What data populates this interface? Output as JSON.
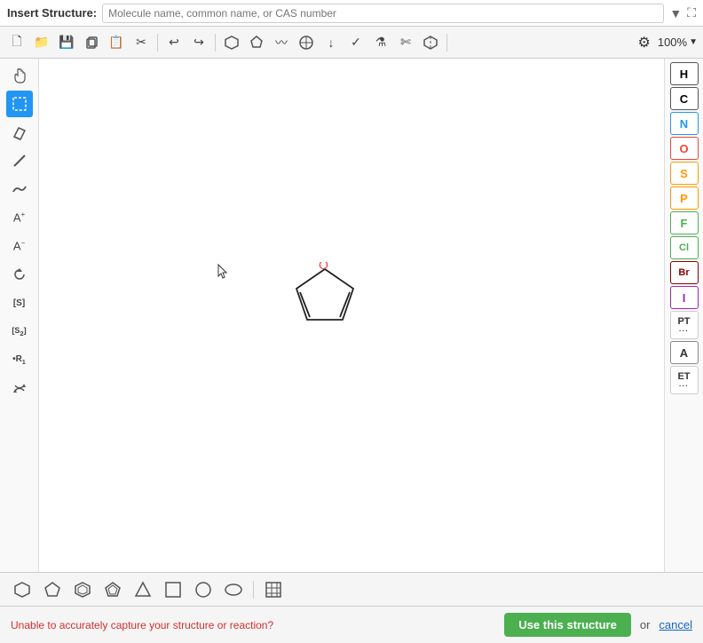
{
  "topbar": {
    "insert_label": "Insert Structure:",
    "input_placeholder": "Molecule name, common name, or CAS number"
  },
  "toolbar": {
    "zoom_level": "100%",
    "buttons": [
      {
        "name": "new-file",
        "icon": "🗋"
      },
      {
        "name": "open-file",
        "icon": "📂"
      },
      {
        "name": "save-file",
        "icon": "💾"
      },
      {
        "name": "copy",
        "icon": "⧉"
      },
      {
        "name": "paste",
        "icon": "📋"
      },
      {
        "name": "cut",
        "icon": "✂"
      },
      {
        "name": "undo",
        "icon": "↩"
      },
      {
        "name": "redo",
        "icon": "↪"
      },
      {
        "name": "ring-hexagon",
        "icon": "⬡"
      },
      {
        "name": "ring-pentagon",
        "icon": "⬠"
      },
      {
        "name": "chain",
        "icon": "〰"
      },
      {
        "name": "atom-map",
        "icon": "⊕"
      },
      {
        "name": "arrow",
        "icon": "↓"
      },
      {
        "name": "check",
        "icon": "✓"
      },
      {
        "name": "flask",
        "icon": "⚗"
      },
      {
        "name": "scissors2",
        "icon": "✄"
      },
      {
        "name": "3d-cube",
        "icon": "◈"
      }
    ]
  },
  "left_tools": [
    {
      "name": "hand-tool",
      "icon": "✋",
      "active": false
    },
    {
      "name": "select-tool",
      "icon": "⬚",
      "active": true
    },
    {
      "name": "eraser-tool",
      "icon": "◆",
      "active": false
    },
    {
      "name": "line-tool",
      "icon": "╱",
      "active": false
    },
    {
      "name": "dash-tool",
      "icon": "〜",
      "active": false
    },
    {
      "name": "text-up-tool",
      "icon": "A⁺",
      "active": false
    },
    {
      "name": "text-down-tool",
      "icon": "A⁻",
      "active": false
    },
    {
      "name": "rotate-tool",
      "icon": "↺",
      "active": false
    },
    {
      "name": "sgroup-tool",
      "icon": "[S]",
      "active": false
    },
    {
      "name": "sgroup2-tool",
      "icon": "[S₂]",
      "active": false
    },
    {
      "name": "rgroup-tool",
      "icon": "R₁",
      "active": false
    },
    {
      "name": "flip-tool",
      "icon": "↕",
      "active": false
    }
  ],
  "right_elements": [
    {
      "symbol": "H",
      "color": "#000000",
      "border": "#000000"
    },
    {
      "symbol": "C",
      "color": "#000000",
      "border": "#000000"
    },
    {
      "symbol": "N",
      "color": "#2196F3",
      "border": "#2196F3"
    },
    {
      "symbol": "O",
      "color": "#f44336",
      "border": "#f44336"
    },
    {
      "symbol": "S",
      "color": "#FF9800",
      "border": "#FF9800"
    },
    {
      "symbol": "P",
      "color": "#FF9800",
      "border": "#FF9800"
    },
    {
      "symbol": "F",
      "color": "#4CAF50",
      "border": "#4CAF50"
    },
    {
      "symbol": "Cl",
      "color": "#4CAF50",
      "border": "#4CAF50"
    },
    {
      "symbol": "Br",
      "color": "#8B0000",
      "border": "#8B0000"
    },
    {
      "symbol": "I",
      "color": "#9C27B0",
      "border": "#9C27B0"
    },
    {
      "symbol": "PT",
      "color": "#333",
      "border": "#ccc",
      "dots": true
    },
    {
      "symbol": "A",
      "color": "#333",
      "border": "#ccc",
      "boxed": true
    },
    {
      "symbol": "ET",
      "color": "#333",
      "border": "#ccc",
      "dots": true
    }
  ],
  "bottom_shapes": [
    {
      "name": "hexagon-shape",
      "icon": "⬡"
    },
    {
      "name": "pentagon-shape",
      "icon": "⬠"
    },
    {
      "name": "square6-shape",
      "icon": "⬡"
    },
    {
      "name": "pentagon2-shape",
      "icon": "⬠"
    },
    {
      "name": "triangle-shape",
      "icon": "△"
    },
    {
      "name": "square-shape",
      "icon": "□"
    },
    {
      "name": "circle-shape",
      "icon": "○"
    },
    {
      "name": "ellipse-shape",
      "icon": "◯"
    },
    {
      "name": "table-shape",
      "icon": "⊞"
    }
  ],
  "statusbar": {
    "error_text": "Unable to accurately capture your structure or reaction?",
    "use_btn_label": "Use this structure",
    "or_text": "or",
    "cancel_label": "cancel"
  },
  "molecule": {
    "label": "Furan",
    "oxygen_label": "O"
  }
}
